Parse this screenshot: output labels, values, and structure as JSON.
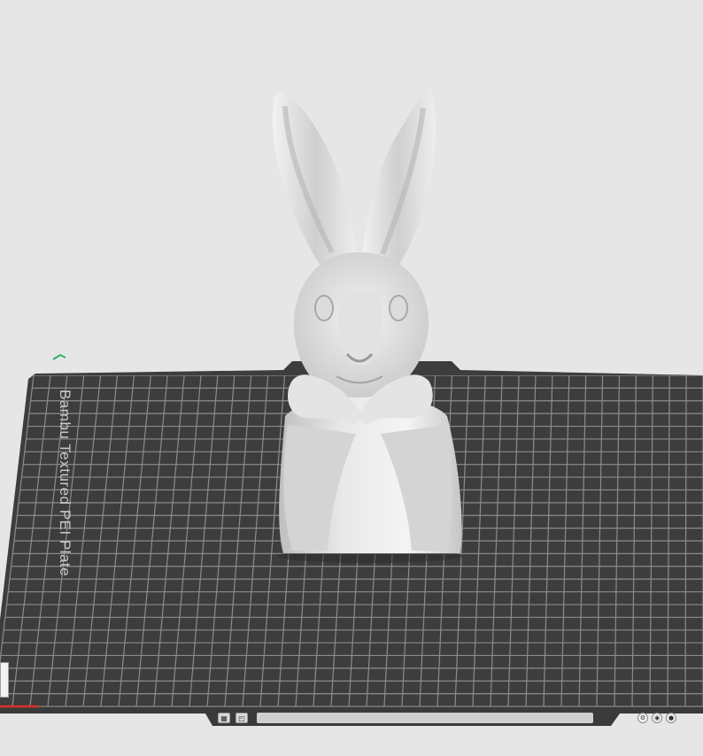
{
  "viewport": {
    "background": "#e6e6e6",
    "plate_color": "#3c3c3c",
    "grid_color": "#8e8e8e",
    "model_color": "#dcdcdc"
  },
  "build_plate": {
    "label": "Bambu Textured PEI Plate"
  },
  "model": {
    "name": "rabbit-bust"
  },
  "axes": {
    "x_color": "#e0302a",
    "y_color": "#2fb36b"
  },
  "toolbar": {
    "icons": [
      "plate-icon",
      "orient-icon",
      "settings-icon",
      "camera-icon",
      "lock-icon"
    ]
  }
}
